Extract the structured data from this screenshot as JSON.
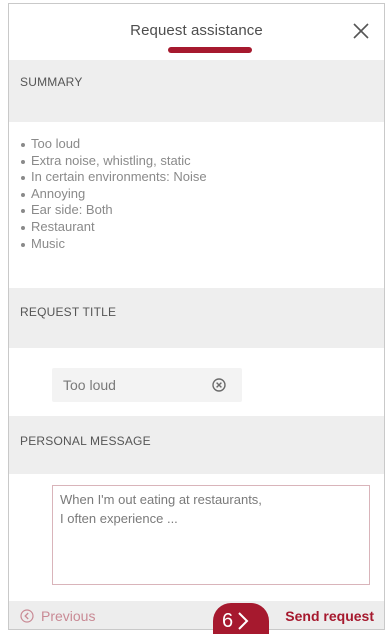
{
  "header": {
    "title": "Request assistance",
    "close_icon": "close-icon"
  },
  "summary": {
    "heading": "SUMMARY",
    "items": [
      "Too loud",
      "Extra noise, whistling, static",
      "In certain environments: Noise",
      "Annoying",
      "Ear side: Both",
      "Restaurant",
      "Music"
    ]
  },
  "request_title": {
    "heading": "REQUEST TITLE",
    "value": "Too loud",
    "clear_icon": "clear-circle-x-icon"
  },
  "personal_message": {
    "heading": "PERSONAL MESSAGE",
    "value": "When I'm out eating at restaurants,\nI often experience ..."
  },
  "footer": {
    "previous_label": "Previous",
    "previous_icon": "chevron-left-circle-icon",
    "send_label": "Send request"
  },
  "step_marker": {
    "number": "6",
    "icon": "chevron-right-icon"
  },
  "colors": {
    "accent": "#a6192e",
    "section_bg": "#eeeeee",
    "text": "#7a7a7a"
  }
}
